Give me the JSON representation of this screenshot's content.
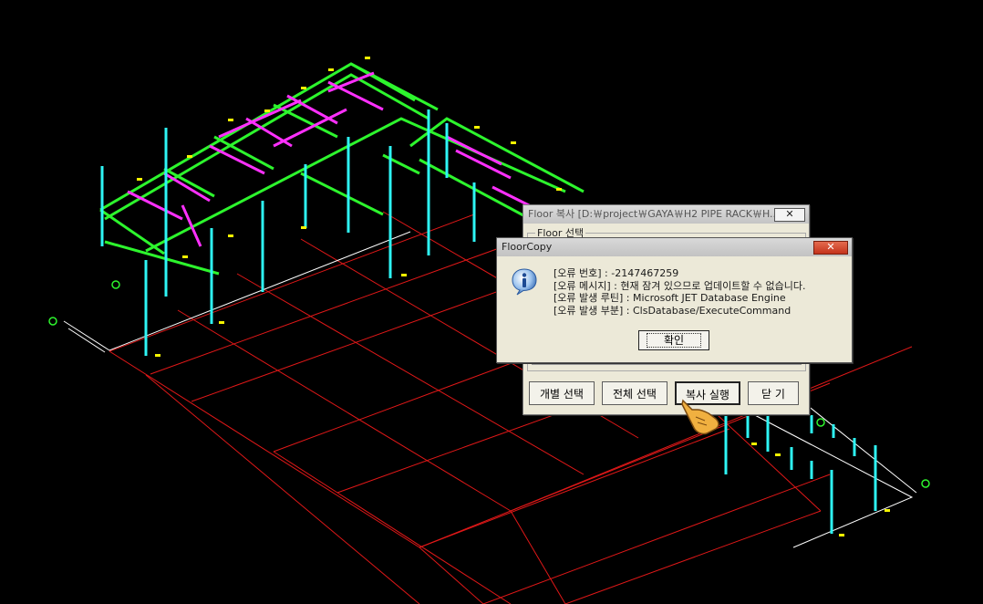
{
  "floor_window": {
    "title": "Floor 복사  [D:￦project￦GAYA￦H2 PIPE RACK￦H...",
    "close_label": "✕",
    "group_label": "Floor 선택",
    "buttons": {
      "individual_select": "개별 선택",
      "select_all": "전체 선택",
      "execute_copy": "복사 실행",
      "close": "닫 기"
    }
  },
  "error_dialog": {
    "title": "FloorCopy",
    "close_label": "✕",
    "icon": "info-icon",
    "lines": [
      "[오류 번호] : -2147467259",
      "[오류 메시지] : 현재 잠겨 있으므로 업데이트할 수 없습니다.",
      "[오류 발생 루틴] : Microsoft JET Database Engine",
      "[오류 발생 부분] : ClsDatabase/ExecuteCommand"
    ],
    "ok_label": "확인"
  },
  "colors": {
    "background": "#000000",
    "grid": "#ff2020",
    "beams": "#33ff33",
    "columns": "#33ffff",
    "braces": "#ff33ff",
    "outline": "#ffffff"
  }
}
